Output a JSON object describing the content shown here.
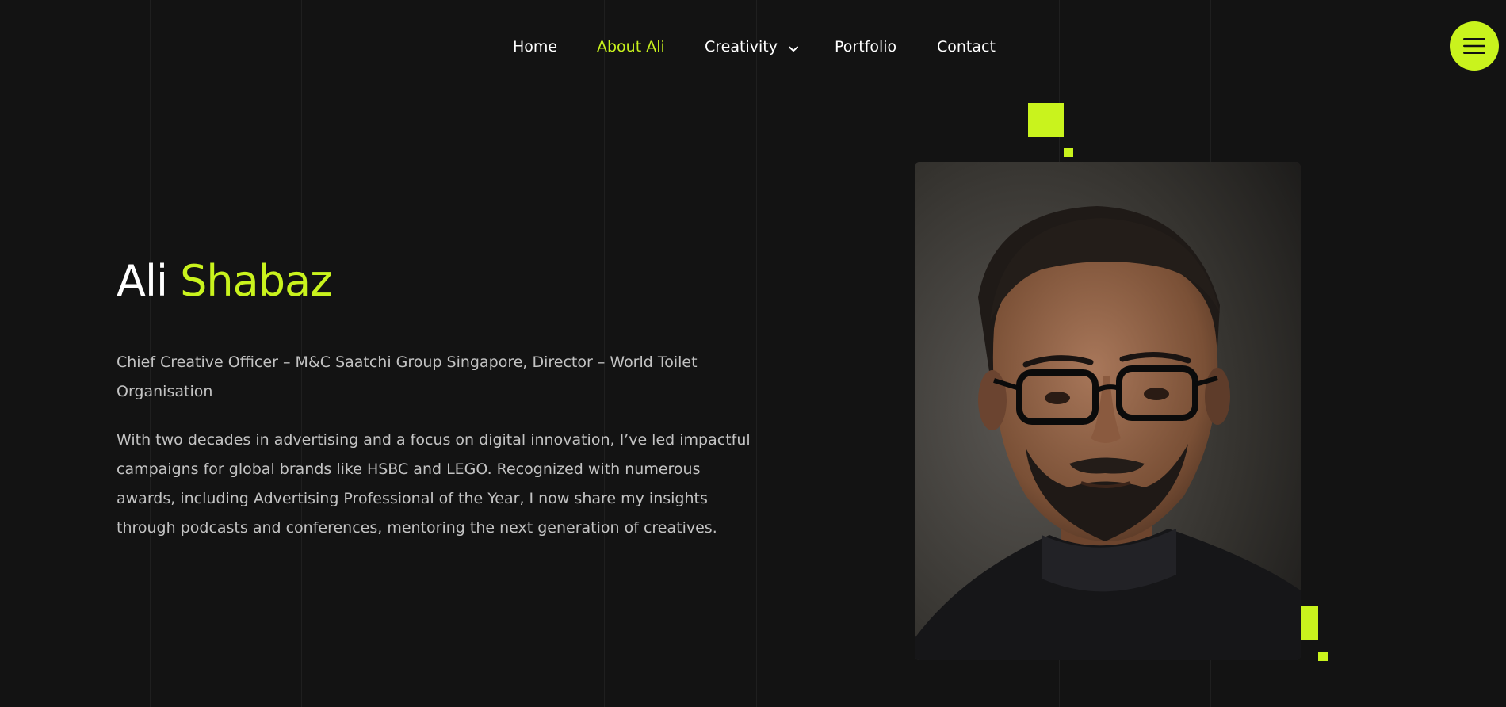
{
  "nav": {
    "items": [
      {
        "label": "Home",
        "active": false
      },
      {
        "label": "About Ali",
        "active": true
      },
      {
        "label": "Creativity",
        "active": false,
        "has_dropdown": true
      },
      {
        "label": "Portfolio",
        "active": false
      },
      {
        "label": "Contact",
        "active": false
      }
    ],
    "menu_icon": "hamburger-icon"
  },
  "hero": {
    "first_name": "Ali",
    "last_name": "Shabaz",
    "role": "Chief Creative Officer – M&C Saatchi Group Singapore, Director – World Toilet Organisation",
    "bio": "With two decades in advertising and a focus on digital innovation, I’ve led impactful campaigns for global brands like HSBC and LEGO. Recognized with numerous awards, including Advertising Professional of the Year, I now share my insights through podcasts and conferences, mentoring the next generation of creatives."
  },
  "colors": {
    "background": "#131313",
    "accent": "#c9f31d",
    "text": "#ffffff",
    "muted_text": "#c3c3c3"
  }
}
